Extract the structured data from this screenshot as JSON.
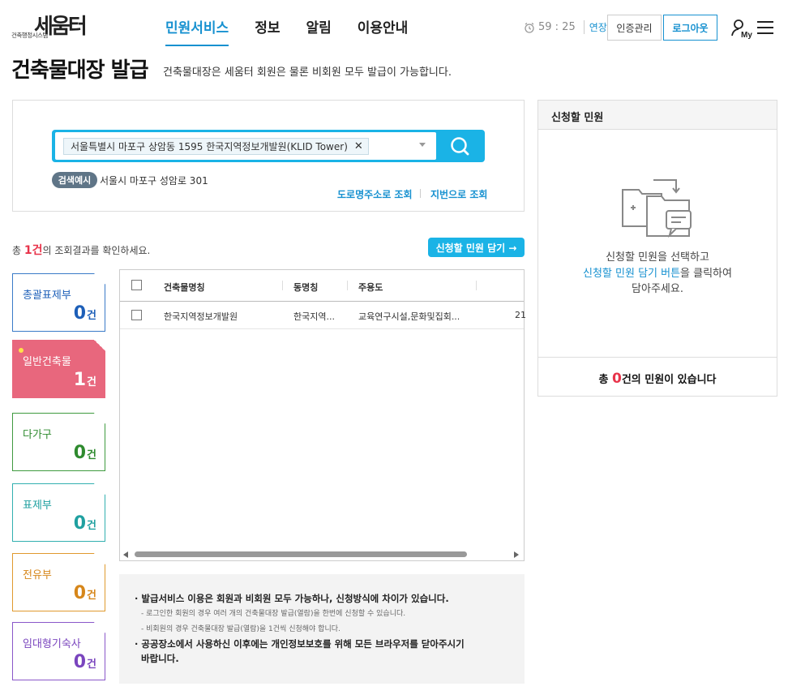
{
  "header": {
    "logo_main": "세움터",
    "logo_sub": "건축행정시스템",
    "nav": [
      "민원서비스",
      "정보",
      "알림",
      "이용안내"
    ],
    "timer": "59 : 25",
    "extend": "연장",
    "cert_btn": "인증관리",
    "logout_btn": "로그아웃",
    "my_label": "My"
  },
  "page": {
    "title": "건축물대장 발급",
    "desc": "건축물대장은 세움터 회원은 물론 비회원 모두 발급이 가능합니다."
  },
  "search": {
    "chip": "서울특별시 마포구 상암동 1595 한국지역정보개발원(KLID Tower)",
    "example_badge": "검색예시",
    "example_text": "서울시 마포구 성암로 301",
    "road_link": "도로명주소로 조회",
    "lot_link": "지번으로 조회"
  },
  "result": {
    "prefix": "총 ",
    "count": "1건",
    "suffix": "의 조회결과를 확인하세요.",
    "add_btn": "신청할 민원 담기 →"
  },
  "categories": [
    {
      "label": "총괄표제부",
      "count": "0",
      "unit": "건"
    },
    {
      "label": "일반건축물",
      "count": "1",
      "unit": "건"
    },
    {
      "label": "다가구",
      "count": "0",
      "unit": "건"
    },
    {
      "label": "표제부",
      "count": "0",
      "unit": "건"
    },
    {
      "label": "전유부",
      "count": "0",
      "unit": "건"
    },
    {
      "label": "임대형기숙사",
      "count": "0",
      "unit": "건"
    }
  ],
  "table": {
    "headers": [
      "건축물명칭",
      "동명칭",
      "주용도"
    ],
    "rows": [
      {
        "name": "한국지역정보개발원",
        "dong": "한국지역...",
        "use": "교육연구시설,문화및집회...",
        "extra": "21"
      }
    ]
  },
  "notice": {
    "line1": "· 발급서비스 이용은 회원과 비회원 모두 가능하나, 신청방식에 차이가 있습니다.",
    "sub1": "- 로그인한 회원의 경우 여러 개의 건축물대장 발급(열람)을 한번에 신청할 수 있습니다.",
    "sub2": "- 비회원의 경우 건축물대장 발급(열람)을 1건씩 신청해야 합니다.",
    "line2a": "· 공공장소에서 사용하신 이후에는 개인정보보호를 위해 모든 브라우저를 닫아주시기",
    "line2b": "바랍니다."
  },
  "right_panel": {
    "title": "신청할 민원",
    "msg1": "신청할 민원을 선택하고",
    "msg2_blue": "신청할 민원 담기 버튼",
    "msg2_rest": "을 클릭하여",
    "msg3": "담아주세요.",
    "total_prefix": "총 ",
    "total_count": "0",
    "total_suffix": "건의 민원이 있습니다"
  }
}
